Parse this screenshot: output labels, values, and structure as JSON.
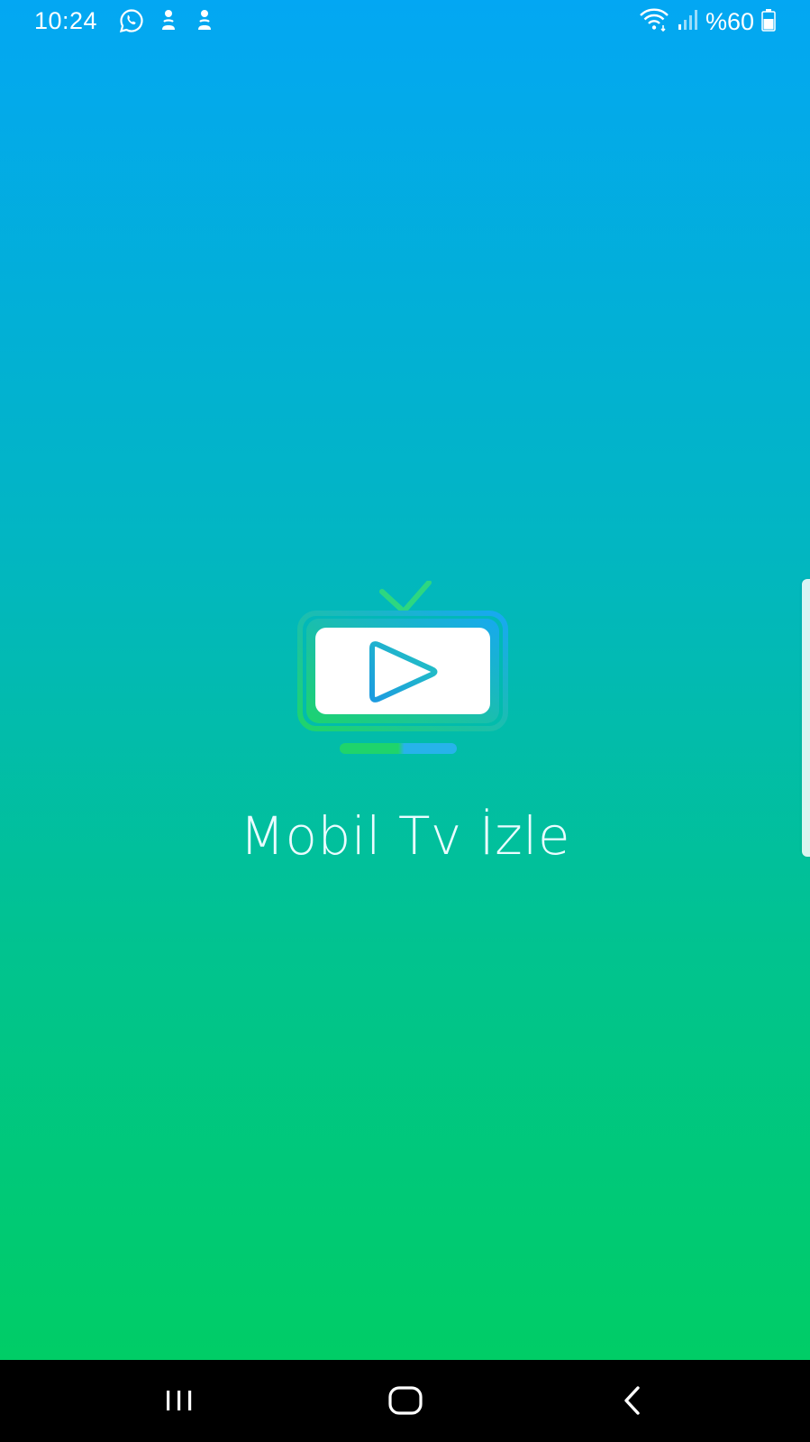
{
  "status_bar": {
    "time": "10:24",
    "notification_icons": [
      "whatsapp-icon",
      "shazam-icon",
      "shazam-icon"
    ],
    "battery_text": "%60",
    "icons": [
      "wifi-icon",
      "signal-icon",
      "battery-icon"
    ]
  },
  "splash": {
    "app_title": "Mobil Tv İzle",
    "logo_icon": "tv-play-icon"
  },
  "nav_bar": {
    "buttons": [
      "recents",
      "home",
      "back"
    ]
  },
  "colors": {
    "gradient_top": "#03a7f3",
    "gradient_bottom": "#00cd66",
    "text": "#eafcff"
  }
}
